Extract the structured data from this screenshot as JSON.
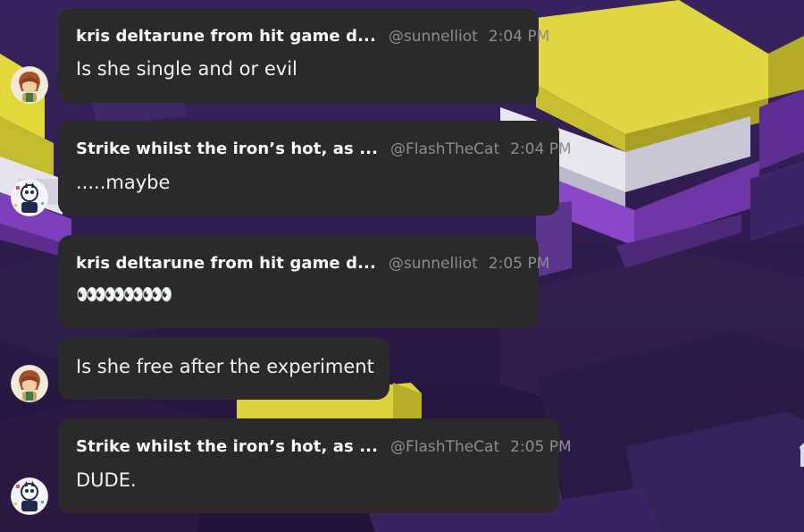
{
  "messages": [
    {
      "author": "kris deltarune from hit game d...",
      "handle": "@sunnelliot",
      "time": "2:04 PM",
      "text": "Is she single and or evil",
      "avatar": "kris-avatar-icon"
    },
    {
      "author": "Strike whilst the iron’s hot, as ...",
      "handle": "@FlashTheCat",
      "time": "2:04 PM",
      "text": ".....maybe",
      "avatar": "flash-avatar-icon"
    },
    {
      "author": "kris deltarune from hit game d...",
      "handle": "@sunnelliot",
      "time": "2:05 PM",
      "text": "👀👀👀👀👀",
      "avatar": "kris-avatar-icon"
    },
    {
      "text": "Is she free after the experiment",
      "avatar": "kris-avatar-icon"
    },
    {
      "author": "Strike whilst the iron’s hot, as ...",
      "handle": "@FlashTheCat",
      "time": "2:05 PM",
      "text": "DUDE.",
      "avatar": "flash-avatar-icon"
    }
  ],
  "colors": {
    "bubble": "#2a2a2a",
    "background": "#2a1a4a",
    "yellow": "#d9cf36",
    "purple": "#8a45c8",
    "white": "#e6e4ee"
  }
}
